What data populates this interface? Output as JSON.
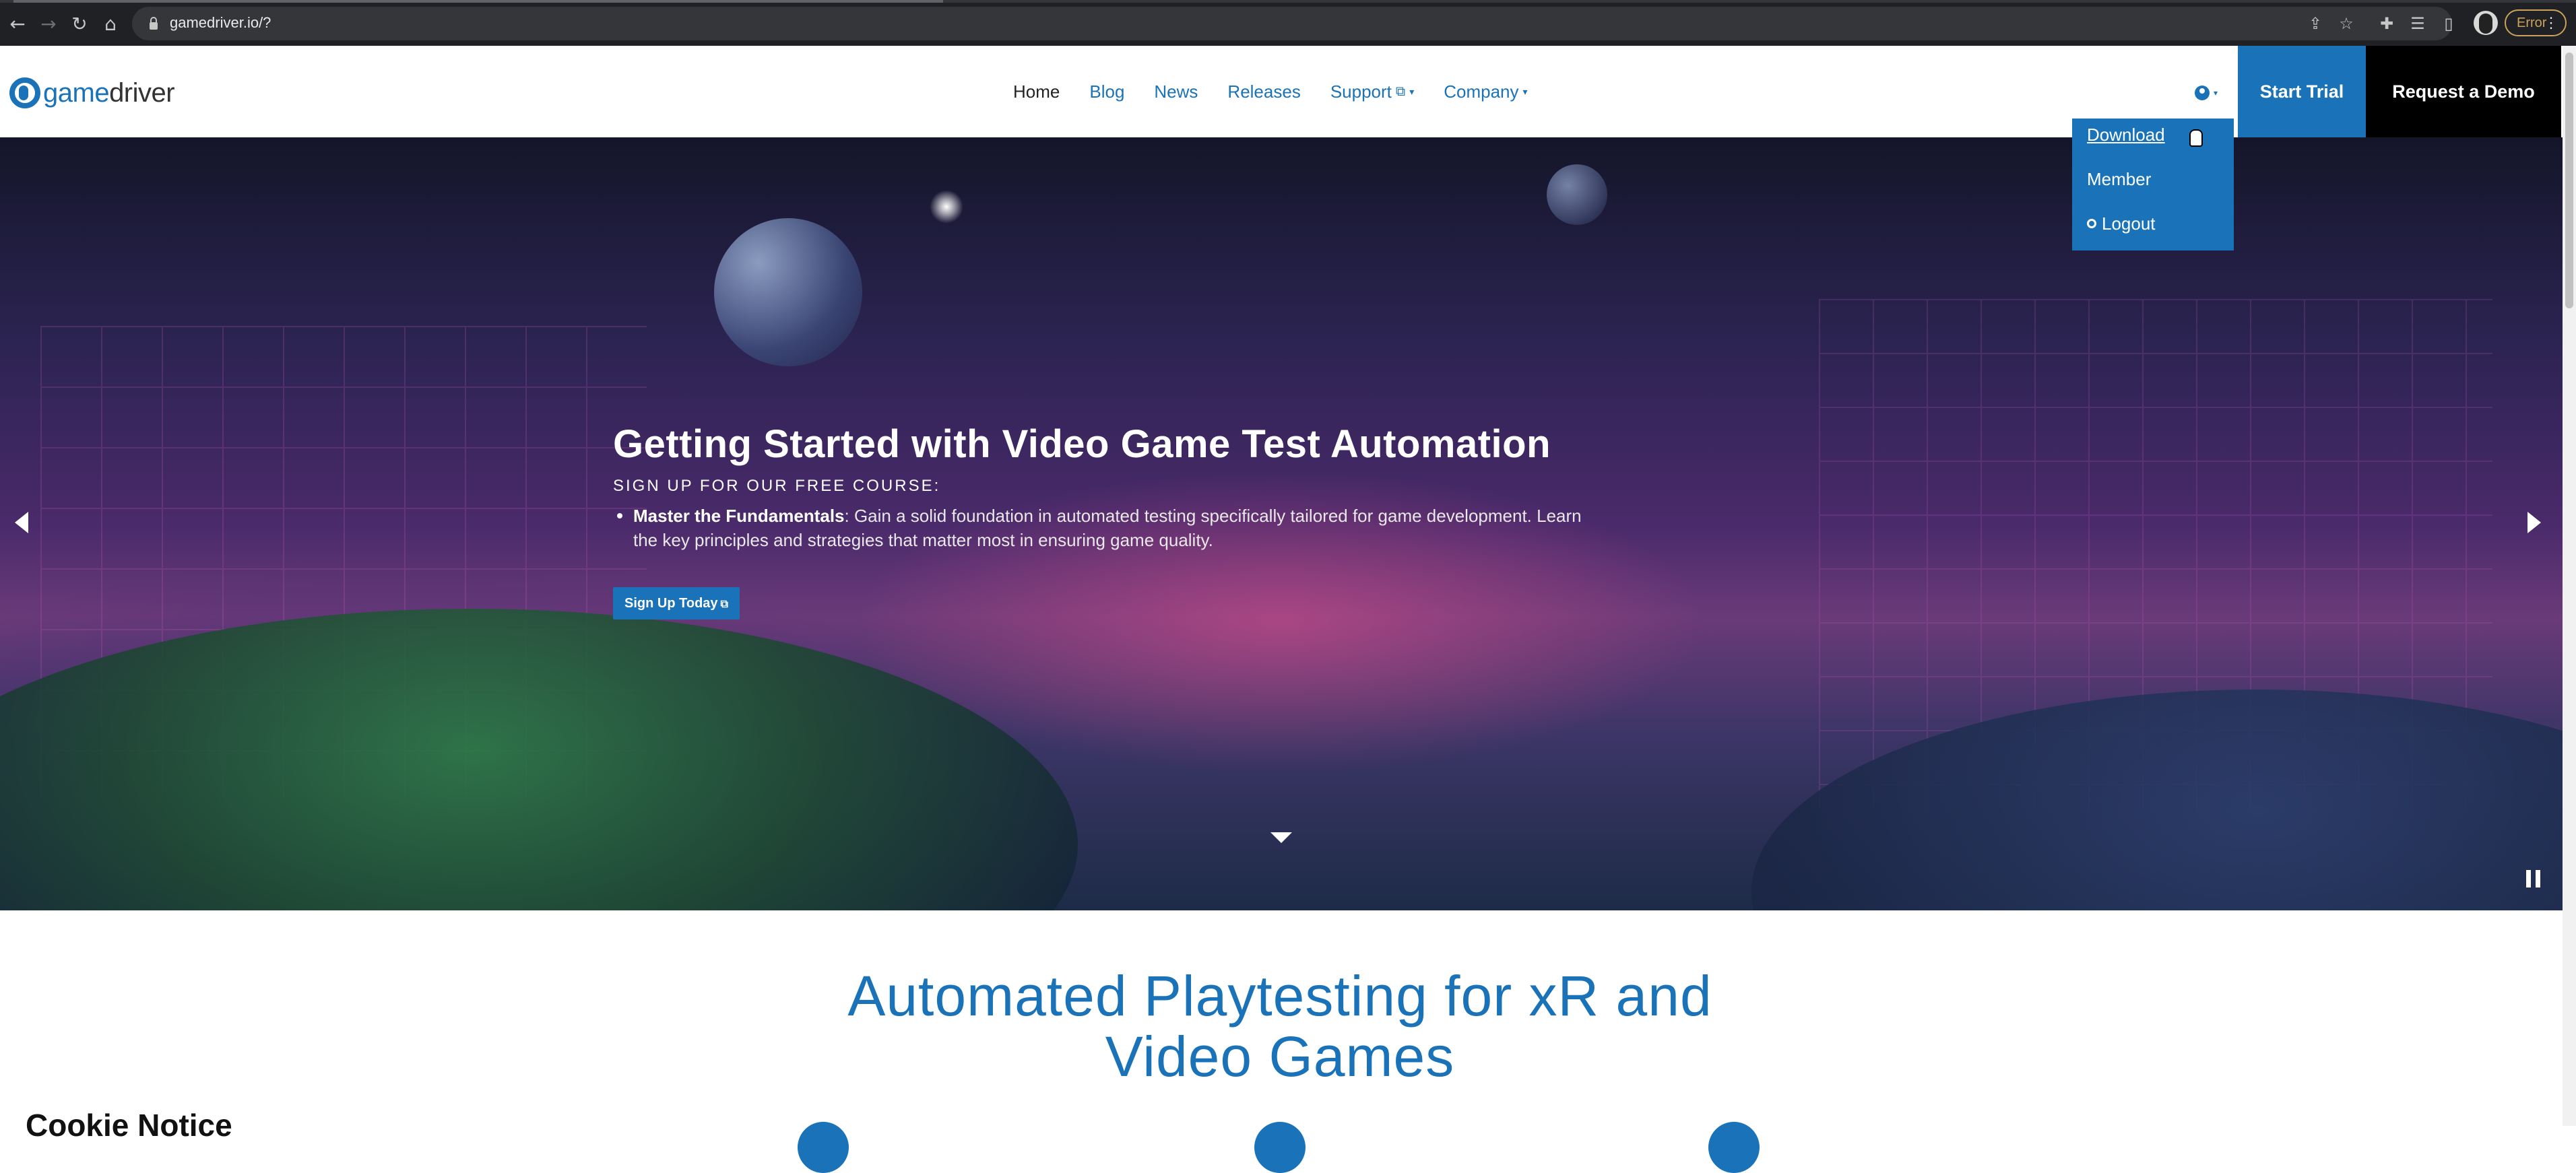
{
  "browser": {
    "url": "gamedriver.io/?",
    "error_label": "Error"
  },
  "header": {
    "logo_text_a": "game",
    "logo_text_b": "driver",
    "nav": [
      {
        "label": "Home"
      },
      {
        "label": "Blog"
      },
      {
        "label": "News"
      },
      {
        "label": "Releases"
      },
      {
        "label": "Support"
      },
      {
        "label": "Company"
      }
    ],
    "start_trial": "Start Trial",
    "request_demo": "Request a Demo"
  },
  "user_menu": {
    "items": [
      {
        "label": "Download"
      },
      {
        "label": "Member"
      },
      {
        "label": "Logout"
      }
    ]
  },
  "hero": {
    "title": "Getting Started with Video Game Test Automation",
    "subtitle": "SIGN UP FOR OUR FREE COURSE:",
    "bullet_lead": "Master the Fundamentals",
    "bullet_text": ": Gain a solid foundation in automated testing specifically tailored for game development. Learn the key principles and strategies that matter most in ensuring game quality.",
    "cta": "Sign Up Today"
  },
  "section": {
    "title_line1": "Automated Playtesting for xR and",
    "title_line2": "Video Games"
  },
  "cookie": {
    "title": "Cookie Notice"
  },
  "colors": {
    "brand_blue": "#1a73b8",
    "demo_black": "#000000"
  }
}
